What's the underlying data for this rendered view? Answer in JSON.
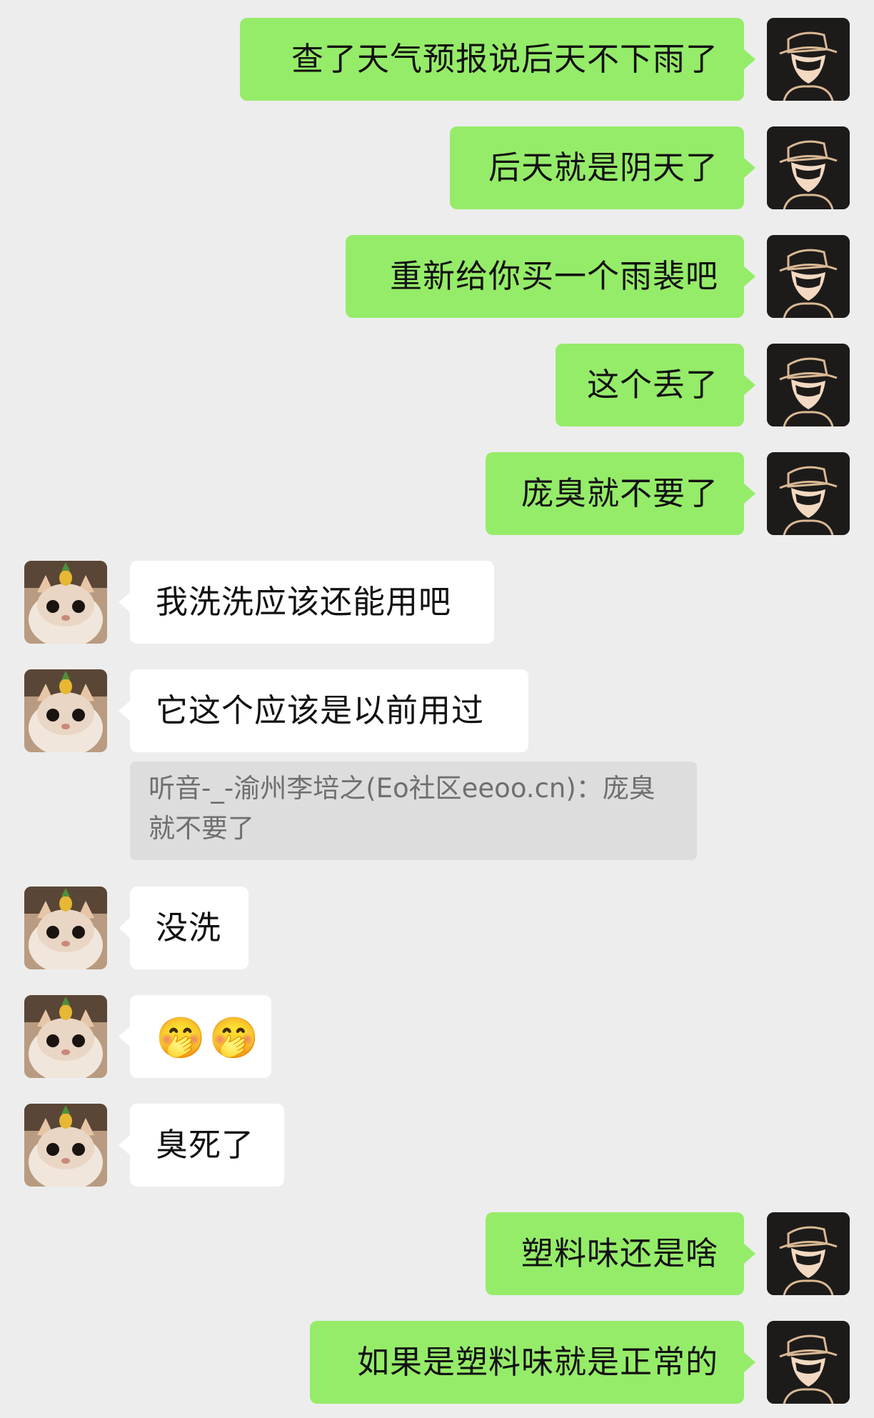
{
  "conversation": {
    "messages": [
      {
        "sender": "me",
        "text": "查了天气预报说后天不下雨了"
      },
      {
        "sender": "me",
        "text": "后天就是阴天了"
      },
      {
        "sender": "me",
        "text": "重新给你买一个雨裴吧"
      },
      {
        "sender": "me",
        "text": "这个丢了"
      },
      {
        "sender": "me",
        "text": "庞臭就不要了"
      },
      {
        "sender": "other",
        "text": "我洗洗应该还能用吧"
      },
      {
        "sender": "other",
        "text": "它这个应该是以前用过",
        "quote": "听音-_-渝州李培之(Eo社区eeoo.cn)：庞臭就不要了"
      },
      {
        "sender": "other",
        "text": "没洗"
      },
      {
        "sender": "other",
        "emojis": [
          "🤭",
          "🤭"
        ]
      },
      {
        "sender": "other",
        "text": "臭死了"
      },
      {
        "sender": "me",
        "text": "塑料味还是啥"
      },
      {
        "sender": "me",
        "text": "如果是塑料味就是正常的"
      }
    ]
  },
  "icons": {
    "me_avatar": "masked-hat-avatar-icon",
    "other_avatar": "cat-with-pineapple-avatar-icon",
    "emoji": "laughing-crying-emoji-icon"
  },
  "colors": {
    "background": "#ededed",
    "my_bubble": "#95ec69",
    "other_bubble": "#ffffff",
    "quote_background": "#dddddd",
    "quote_text": "#6f6f6f",
    "text": "#111111"
  }
}
